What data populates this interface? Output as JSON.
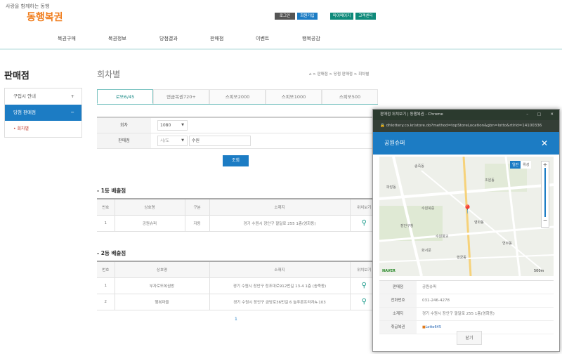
{
  "header": {
    "slogan": "사랑을 함께하는 동행",
    "logo": "동행복권",
    "buttons": {
      "login": "로그인",
      "join": "회원가입",
      "mypage": "마이페이지",
      "support": "고객센터"
    },
    "nav": [
      "복권구매",
      "복권정보",
      "당첨결과",
      "판매점",
      "이벤트",
      "행복공감"
    ]
  },
  "page": {
    "title": "판매점",
    "subtitle": "회차별",
    "breadcrumb": [
      "판매점",
      "당첨 판매점",
      "회차별"
    ]
  },
  "sidebar": {
    "items": [
      {
        "label": "구입시 안내",
        "sign": "+"
      },
      {
        "label": "당첨 판매점",
        "sign": "−"
      }
    ],
    "sub": "회차별"
  },
  "tabs": [
    "로또6/45",
    "연금복권720+",
    "스피또2000",
    "스피또1000",
    "스피또500"
  ],
  "form": {
    "round_label": "회차",
    "round_value": "1080",
    "store_label": "판매점",
    "region_value": "시/도",
    "keyword_value": "수원",
    "search": "조회"
  },
  "first": {
    "title": "- 1등 배출점",
    "headers": [
      "번호",
      "상호명",
      "구분",
      "소재지",
      "위치보기"
    ],
    "rows": [
      {
        "no": "1",
        "name": "공원슈퍼",
        "type": "자동",
        "addr": "경기 수원시 장안구 팔달로 255 1층(영화동)"
      }
    ]
  },
  "second": {
    "title": "- 2등 배출점",
    "headers": [
      "번호",
      "상호명",
      "소재지",
      "위치보기"
    ],
    "rows": [
      {
        "no": "1",
        "name": "부자로또복권방",
        "addr": "경기 수원시 장안구 정조대로912번길 13-4 1층 (송죽동)"
      },
      {
        "no": "2",
        "name": "행복마을",
        "addr": "경기 수원시 장안구 금당로36번길 6 늘푸른프라자A-103"
      }
    ]
  },
  "pagination": "1",
  "popup": {
    "window_title": "판매점 위치보기 | 동행복권 - Chrome",
    "url": "dhlottery.co.kr/store.do?method=topStoreLocation&gbn=lotto&rtlrId=14100336",
    "store": "공원슈퍼",
    "map_type": [
      "일반",
      "위성"
    ],
    "info": [
      {
        "label": "판매점",
        "value": "공원슈퍼"
      },
      {
        "label": "전화번호",
        "value": "031-246-4278"
      },
      {
        "label": "소재지",
        "value": "경기 수원시 장안구 팔달로 255 1층(영화동)"
      },
      {
        "label": "취급복권",
        "value": "Lotto645"
      }
    ],
    "close": "닫기",
    "map_labels": [
      "송죽동",
      "조원동",
      "영화동",
      "파장동",
      "연무동",
      "수원북중",
      "수원향교",
      "화서문",
      "장안구청",
      "행궁동"
    ],
    "scale": "500m",
    "map_brand": "NAVER"
  }
}
